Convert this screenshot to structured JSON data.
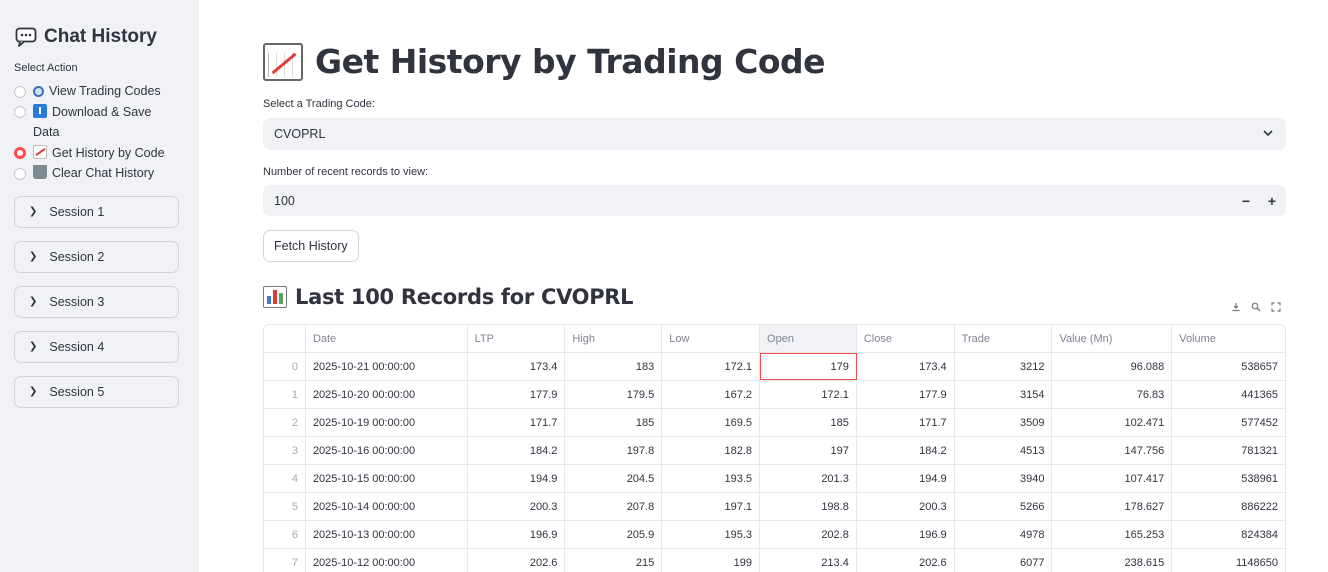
{
  "sidebar": {
    "title": "Chat History",
    "action_label": "Select Action",
    "actions": [
      {
        "label": "View Trading Codes",
        "icon": "magnifier-icon",
        "checked": false
      },
      {
        "label": "Download & Save",
        "label2": "Data",
        "icon": "download-icon",
        "checked": false
      },
      {
        "label": "Get History by Code",
        "icon": "chart-increasing-icon",
        "checked": true
      },
      {
        "label": "Clear Chat History",
        "icon": "trash-icon",
        "checked": false
      }
    ],
    "sessions": [
      "Session 1",
      "Session 2",
      "Session 3",
      "Session 4",
      "Session 5"
    ]
  },
  "main": {
    "title": "Get History by Trading Code",
    "select_label": "Select a Trading Code:",
    "select_value": "CVOPRL",
    "records_label": "Number of recent records to view:",
    "records_value": "100",
    "minus": "−",
    "plus": "+",
    "fetch_button": "Fetch History",
    "subtitle": "Last 100 Records for CVOPRL"
  },
  "table": {
    "columns": [
      "",
      "Date",
      "LTP",
      "High",
      "Low",
      "Open",
      "Close",
      "Trade",
      "Value (Mn)",
      "Volume"
    ],
    "rows": [
      [
        "0",
        "2025-10-21 00:00:00",
        "173.4",
        "183",
        "172.1",
        "179",
        "173.4",
        "3212",
        "96.088",
        "538657"
      ],
      [
        "1",
        "2025-10-20 00:00:00",
        "177.9",
        "179.5",
        "167.2",
        "172.1",
        "177.9",
        "3154",
        "76.83",
        "441365"
      ],
      [
        "2",
        "2025-10-19 00:00:00",
        "171.7",
        "185",
        "169.5",
        "185",
        "171.7",
        "3509",
        "102.471",
        "577452"
      ],
      [
        "3",
        "2025-10-16 00:00:00",
        "184.2",
        "197.8",
        "182.8",
        "197",
        "184.2",
        "4513",
        "147.756",
        "781321"
      ],
      [
        "4",
        "2025-10-15 00:00:00",
        "194.9",
        "204.5",
        "193.5",
        "201.3",
        "194.9",
        "3940",
        "107.417",
        "538961"
      ],
      [
        "5",
        "2025-10-14 00:00:00",
        "200.3",
        "207.8",
        "197.1",
        "198.8",
        "200.3",
        "5266",
        "178.627",
        "886222"
      ],
      [
        "6",
        "2025-10-13 00:00:00",
        "196.9",
        "205.9",
        "195.3",
        "202.8",
        "196.9",
        "4978",
        "165.253",
        "824384"
      ],
      [
        "7",
        "2025-10-12 00:00:00",
        "202.6",
        "215",
        "199",
        "213.4",
        "202.6",
        "6077",
        "238.615",
        "1148650"
      ]
    ]
  }
}
